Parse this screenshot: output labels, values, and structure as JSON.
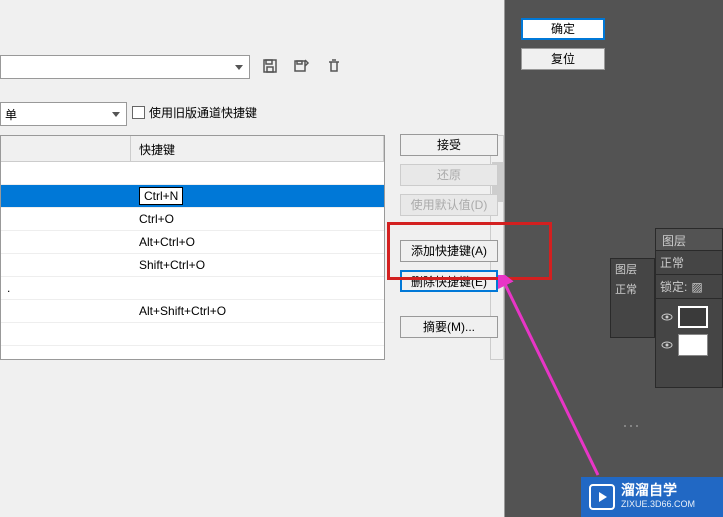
{
  "dialog": {
    "ok": "确定",
    "reset": "复位",
    "dropdown2_label": "单",
    "legacy_checkbox": "使用旧版通道快捷键",
    "header_shortcut": "快捷键"
  },
  "rows": [
    {
      "cmd": "",
      "key": ""
    },
    {
      "cmd": "",
      "key": "Ctrl+N",
      "selected": true
    },
    {
      "cmd": "",
      "key": "Ctrl+O"
    },
    {
      "cmd": "",
      "key": "Alt+Ctrl+O"
    },
    {
      "cmd": "",
      "key": "Shift+Ctrl+O"
    },
    {
      "cmd": ".",
      "key": ""
    },
    {
      "cmd": "",
      "key": "Alt+Shift+Ctrl+O"
    },
    {
      "cmd": "",
      "key": ""
    }
  ],
  "buttons": {
    "accept": "接受",
    "undo": "还原",
    "defaults": "使用默认值(D)",
    "add": "添加快捷键(A)",
    "delete": "删除快捷键(E)",
    "summary": "摘要(M)..."
  },
  "panels": {
    "layers_tab": "图层",
    "blend": "正常",
    "lock": "锁定:",
    "small_layers": "图层",
    "small_blend": "正常"
  },
  "watermark": {
    "main": "溜溜自学",
    "sub": "ZIXUE.3D66.COM"
  }
}
